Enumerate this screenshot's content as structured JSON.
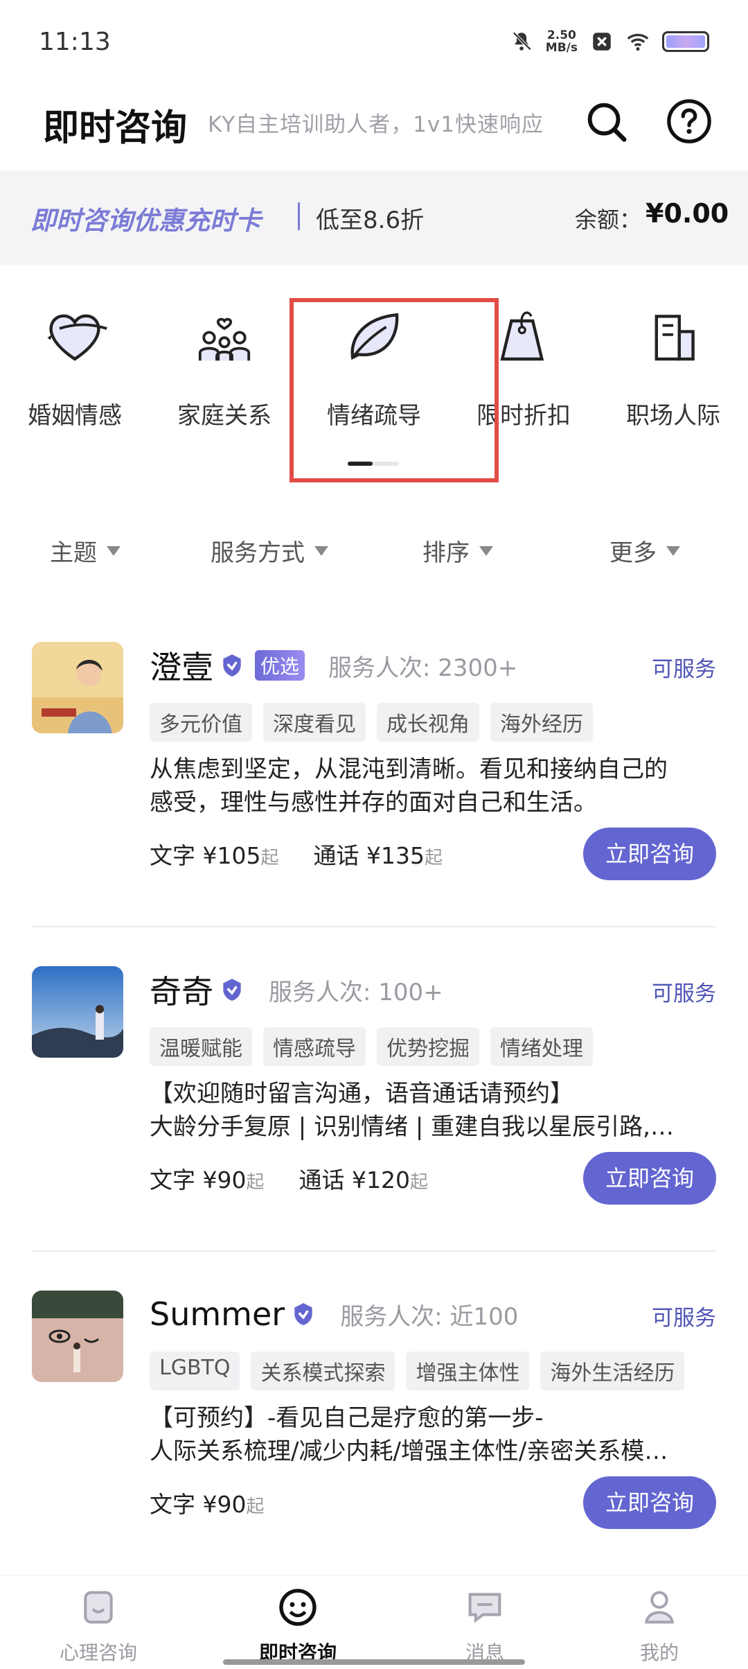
{
  "status_bar": {
    "time": "11:13",
    "net_speed_value": "2.50",
    "net_speed_unit": "MB/s",
    "icons": [
      "bell-mute-icon",
      "close-box-icon",
      "wifi-icon",
      "battery-icon"
    ]
  },
  "header": {
    "title": "即时咨询",
    "subtitle": "KY自主培训助人者，1v1快速响应",
    "icons": [
      "search-icon",
      "help-icon"
    ]
  },
  "promo": {
    "title": "即时咨询优惠充时卡",
    "discount": "低至8.6折",
    "balance_label": "余额：",
    "balance_value": "¥0.00"
  },
  "categories": [
    {
      "label": "婚姻情感",
      "icon": "heart-icon"
    },
    {
      "label": "家庭关系",
      "icon": "family-icon"
    },
    {
      "label": "情绪疏导",
      "icon": "leaf-icon"
    },
    {
      "label": "限时折扣",
      "icon": "price-tag-icon"
    },
    {
      "label": "职场人际",
      "icon": "building-icon"
    }
  ],
  "filters": [
    {
      "label": "主题"
    },
    {
      "label": "服务方式"
    },
    {
      "label": "排序"
    },
    {
      "label": "更多"
    }
  ],
  "counselors": [
    {
      "name": "澄壹",
      "badge": "优选",
      "served": "服务人次: 2300+",
      "status": "可服务",
      "tags": [
        "多元价值",
        "深度看见",
        "成长视角",
        "海外经历"
      ],
      "desc_line1": "从焦虑到坚定，从混沌到清晰。看见和接纳自己的",
      "desc_line2": "感受，理性与感性并存的面对自己和生活。",
      "text_price": "文字 ¥105",
      "call_price": "通话 ¥135",
      "price_suffix": "起",
      "button": "立即咨询"
    },
    {
      "name": "奇奇",
      "served": "服务人次: 100+",
      "status": "可服务",
      "tags": [
        "温暖赋能",
        "情感疏导",
        "优势挖掘",
        "情绪处理"
      ],
      "desc_line1": "【欢迎随时留言沟通，语音通话请预约】",
      "desc_line2": "大龄分手复原 | 识别情绪 | 重建自我以星辰引路,…",
      "text_price": "文字 ¥90",
      "call_price": "通话 ¥120",
      "price_suffix": "起",
      "button": "立即咨询"
    },
    {
      "name": "Summer",
      "served": "服务人次: 近100",
      "status": "可服务",
      "tags": [
        "LGBTQ",
        "关系模式探索",
        "增强主体性",
        "海外生活经历"
      ],
      "desc_line1": "【可预约】-看见自己是疗愈的第一步-",
      "desc_line2": "人际关系梳理/减少内耗/增强主体性/亲密关系模…",
      "text_price": "文字 ¥90",
      "price_suffix": "起",
      "button": "立即咨询"
    }
  ],
  "bottom_nav": [
    {
      "label": "心理咨询",
      "icon": "tablet-smile-icon"
    },
    {
      "label": "即时咨询",
      "icon": "smiley-icon",
      "active": true
    },
    {
      "label": "消息",
      "icon": "chat-icon"
    },
    {
      "label": "我的",
      "icon": "user-icon"
    }
  ],
  "colors": {
    "accent": "#6366d0",
    "promo_text": "#7b7bd6",
    "highlight": "#e24c46",
    "status_text": "#4f55b5"
  }
}
